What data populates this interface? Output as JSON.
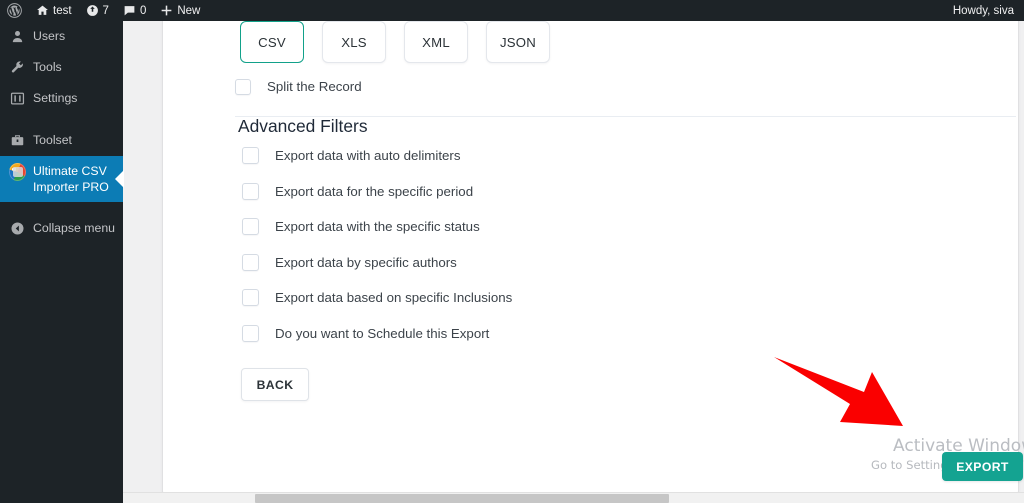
{
  "adminbar": {
    "logo_icon": "wordpress-logo-icon",
    "site_icon": "home-icon",
    "site_name": "test",
    "updates_icon": "updates-icon",
    "updates_count": "7",
    "comments_icon": "comment-bubble-icon",
    "comments_count": "0",
    "new_icon": "plus-icon",
    "new_label": "New",
    "howdy": "Howdy, siva"
  },
  "sidebar": {
    "items": [
      {
        "label": "Users",
        "icon": "user-icon",
        "active": false
      },
      {
        "label": "Tools",
        "icon": "wrench-icon",
        "active": false
      },
      {
        "label": "Settings",
        "icon": "sliders-icon",
        "active": false
      },
      {
        "label": "Toolset",
        "icon": "toolbox-icon",
        "active": false
      },
      {
        "label": "Ultimate CSV Importer PRO",
        "icon": "csv-importer-icon",
        "active": true
      },
      {
        "label": "Collapse menu",
        "icon": "collapse-arrow-icon",
        "active": false
      }
    ]
  },
  "main": {
    "format_tabs": [
      {
        "label": "CSV",
        "selected": true
      },
      {
        "label": "XLS",
        "selected": false
      },
      {
        "label": "XML",
        "selected": false
      },
      {
        "label": "JSON",
        "selected": false
      }
    ],
    "split_record": {
      "label": "Split the Record",
      "checked": false
    },
    "section_title": "Advanced Filters",
    "filters": [
      {
        "label": "Export data with auto delimiters",
        "checked": false
      },
      {
        "label": "Export data for the specific period",
        "checked": false
      },
      {
        "label": "Export data with the specific status",
        "checked": false
      },
      {
        "label": "Export data by specific authors",
        "checked": false
      },
      {
        "label": "Export data based on specific Inclusions",
        "checked": false
      },
      {
        "label": "Do you want to Schedule this Export",
        "checked": false
      }
    ],
    "back_label": "BACK",
    "export_label": "EXPORT"
  },
  "annotation": {
    "arrow_icon": "red-arrow-icon",
    "arrow_color": "#fa0000"
  },
  "watermark": {
    "title": "Activate Windows",
    "subtitle": "Go to Settings to activate Windows."
  },
  "colors": {
    "accent_teal": "#14a391",
    "tab_selected_border": "#12a18a",
    "sidebar_bg": "#1d2327",
    "sidebar_active": "#0c7cb5",
    "page_bg": "#f0f0f1"
  }
}
